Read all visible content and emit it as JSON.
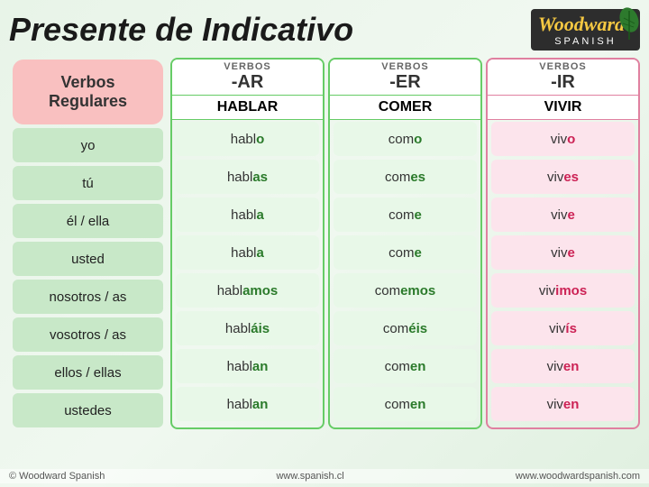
{
  "header": {
    "title": "Presente de Indicativo",
    "logo_brand": "Woodward",
    "logo_reg": "®",
    "logo_sub": "SPANISH"
  },
  "subjects": {
    "section_label": "Verbos",
    "section_label2": "Regulares",
    "rows": [
      "yo",
      "tú",
      "él / ella",
      "usted",
      "nosotros / as",
      "vosotros / as",
      "ellos / ellas",
      "ustedes"
    ]
  },
  "columns": {
    "ar": {
      "verbos_label": "VERBOS",
      "type_label": "-AR",
      "verb": "HABLAR",
      "conjugations": [
        {
          "base": "habl",
          "ending": "o"
        },
        {
          "base": "habl",
          "ending": "as"
        },
        {
          "base": "habl",
          "ending": "a"
        },
        {
          "base": "habl",
          "ending": "a"
        },
        {
          "base": "habl",
          "ending": "amos"
        },
        {
          "base": "habl",
          "ending": "áis"
        },
        {
          "base": "habl",
          "ending": "an"
        },
        {
          "base": "habl",
          "ending": "an"
        }
      ]
    },
    "er": {
      "verbos_label": "VERBOS",
      "type_label": "-ER",
      "verb": "COMER",
      "conjugations": [
        {
          "base": "com",
          "ending": "o"
        },
        {
          "base": "com",
          "ending": "es"
        },
        {
          "base": "com",
          "ending": "e"
        },
        {
          "base": "com",
          "ending": "e"
        },
        {
          "base": "com",
          "ending": "emos"
        },
        {
          "base": "com",
          "ending": "éis"
        },
        {
          "base": "com",
          "ending": "en"
        },
        {
          "base": "com",
          "ending": "en"
        }
      ]
    },
    "ir": {
      "verbos_label": "VERBOS",
      "type_label": "-IR",
      "verb": "VIVIR",
      "conjugations": [
        {
          "base": "viv",
          "ending": "o"
        },
        {
          "base": "viv",
          "ending": "es"
        },
        {
          "base": "viv",
          "ending": "e"
        },
        {
          "base": "viv",
          "ending": "e"
        },
        {
          "base": "viv",
          "ending": "imos"
        },
        {
          "base": "viv",
          "ending": "ís"
        },
        {
          "base": "viv",
          "ending": "en"
        },
        {
          "base": "viv",
          "ending": "en"
        }
      ]
    }
  },
  "footer": {
    "left": "© Woodward Spanish",
    "center": "www.spanish.cl",
    "right": "www.woodwardspanish.com"
  }
}
